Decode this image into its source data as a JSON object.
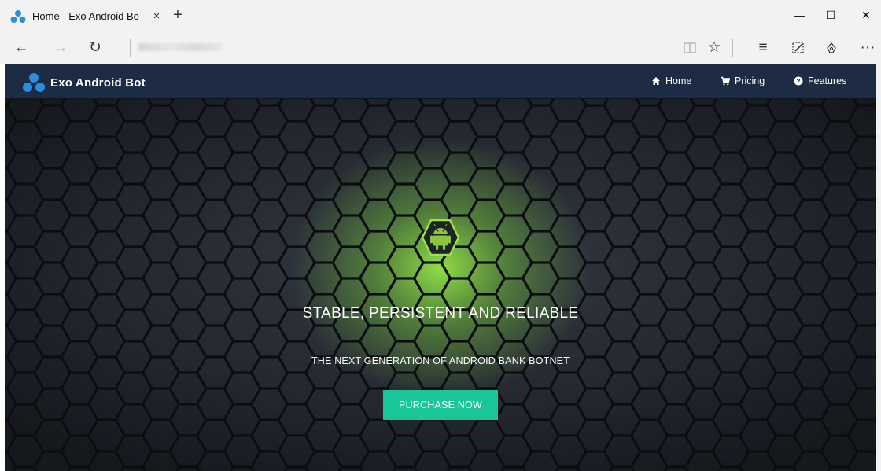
{
  "browser": {
    "tab_title": "Home - Exo Android Bo",
    "tab_close": "×",
    "new_tab": "+",
    "window_controls": {
      "minimize": "—",
      "maximize": "☐",
      "close": "✕"
    },
    "toolbar": {
      "back": "←",
      "forward": "→",
      "refresh": "↻",
      "reading_view": "📖",
      "favorite": "☆",
      "hub": "≡",
      "web_note": "✎",
      "share": "⚘",
      "more": "···"
    },
    "icons": [
      "reading-view-icon",
      "favorite-star-icon",
      "hub-icon",
      "web-note-icon",
      "share-icon",
      "more-icon"
    ]
  },
  "site": {
    "brand": "Exo Android Bot",
    "nav": [
      {
        "label": "Home",
        "icon": "home-icon"
      },
      {
        "label": "Pricing",
        "icon": "cart-icon"
      },
      {
        "label": "Features",
        "icon": "question-circle-icon"
      }
    ],
    "hero": {
      "title": "STABLE, PERSISTENT AND RELIABLE",
      "subtitle": "THE NEXT GENERATION OF ANDROID BANK BOTNET",
      "cta": "PURCHASE NOW",
      "icon": "android-icon"
    },
    "colors": {
      "navbar": "#1d2c44",
      "accent_green": "#1bc59a",
      "glow": "#8de03a",
      "brand_blue": "#2a8de0"
    }
  }
}
